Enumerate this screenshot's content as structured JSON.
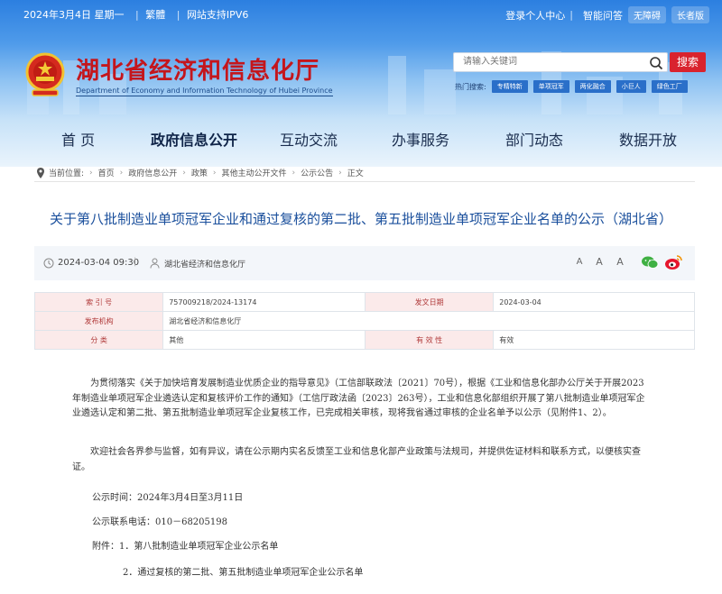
{
  "topbar": {
    "date": "2024年3月4日 星期一",
    "lang": "繁體",
    "ipv6": "网站支持IPV6",
    "links": [
      "登录个人中心",
      "智能问答"
    ],
    "pills": [
      "无障碍",
      "长者版"
    ]
  },
  "brand": {
    "title": "湖北省经济和信息化厅",
    "subtitle": "Department of Economy and Information Technology of Hubei Province"
  },
  "search": {
    "placeholder": "请输入关键词",
    "button": "搜索",
    "hot_label": "热门搜索:",
    "hot_tags": [
      "专精特新",
      "单项冠军",
      "两化融合",
      "小巨人",
      "绿色工厂"
    ]
  },
  "nav": [
    "首 页",
    "政府信息公开",
    "互动交流",
    "办事服务",
    "部门动态",
    "数据开放"
  ],
  "breadcrumb": {
    "label": "当前位置:",
    "items": [
      "首页",
      "政府信息公开",
      "政策",
      "其他主动公开文件",
      "公示公告",
      "正文"
    ]
  },
  "article": {
    "title": "关于第八批制造业单项冠军企业和通过复核的第二批、第五批制造业单项冠军企业名单的公示（湖北省）",
    "time": "2024-03-04 09:30",
    "source": "湖北省经济和信息化厅",
    "font_sizes": [
      "A",
      "A",
      "A"
    ],
    "share_icons": [
      "wechat-icon",
      "weibo-icon"
    ]
  },
  "info_table": {
    "rows": [
      {
        "k1": "索 引 号",
        "v1": "757009218/2024-13174",
        "k2": "发文日期",
        "v2": "2024-03-04"
      },
      {
        "k1": "发布机构",
        "v1": "湖北省经济和信息化厅",
        "k2": "",
        "v2": ""
      },
      {
        "k1": "分    类",
        "v1": "其他",
        "k2": "有 效 性",
        "v2": "有效"
      }
    ]
  },
  "body": {
    "p1": "为贯彻落实《关于加快培育发展制造业优质企业的指导意见》（工信部联政法〔2021〕70号），根据《工业和信息化部办公厅关于开展2023年制造业单项冠军企业遴选认定和复核评价工作的通知》（工信厅政法函〔2023〕263号），工业和信息化部组织开展了第八批制造业单项冠军企业遴选认定和第二批、第五批制造业单项冠军企业复核工作，已完成相关审核，现将我省通过审核的企业名单予以公示（见附件1、2）。",
    "p2": "欢迎社会各界参与监督，如有异议，请在公示期内实名反馈至工业和信息化部产业政策与法规司，并提供佐证材料和联系方式，以便核实查证。",
    "p3": "公示时间：2024年3月4日至3月11日",
    "p4": "公示联系电话：010－68205198",
    "p5": "附件：1．第八批制造业单项冠军企业公示名单",
    "p6": "2．通过复核的第二批、第五批制造业单项冠军企业公示名单"
  },
  "colors": {
    "brand_red": "#c4161c",
    "title_blue": "#1a4f9c",
    "header_blue": "#2c7fe0"
  }
}
